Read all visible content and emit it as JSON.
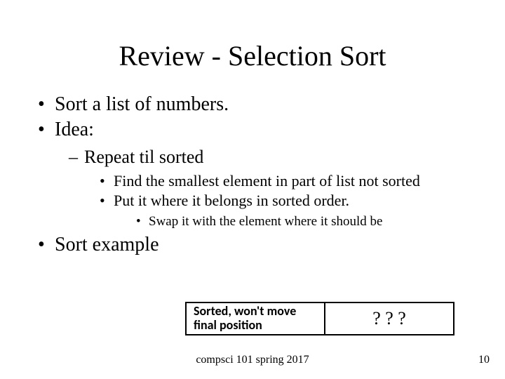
{
  "title": "Review - Selection Sort",
  "bullets": {
    "b1": "Sort a list of numbers.",
    "b2": "Idea:",
    "b2_1": "Repeat til sorted",
    "b2_1_1": "Find the smallest element in part of list not sorted",
    "b2_1_2": "Put it where it belongs in sorted order.",
    "b2_1_2_1": "Swap it with the element where it should be",
    "b3": "Sort example"
  },
  "boxes": {
    "left": "Sorted, won't move final position",
    "right": "? ? ?"
  },
  "footer": {
    "center": "compsci 101 spring 2017",
    "page": "10"
  }
}
